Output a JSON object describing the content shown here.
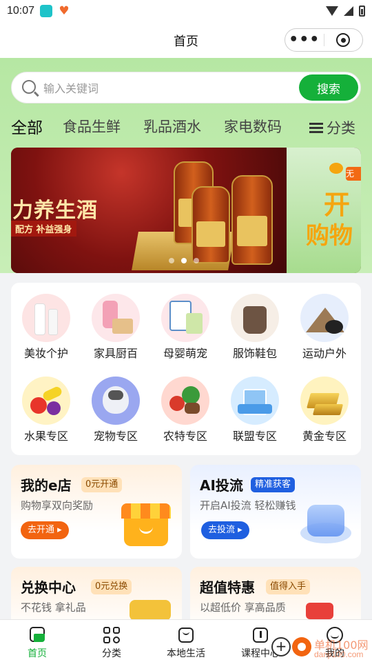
{
  "status_bar": {
    "time": "10:07"
  },
  "nav": {
    "title": "首页",
    "more_icon": "•••"
  },
  "search": {
    "placeholder": "输入关键词",
    "button": "搜索"
  },
  "tabs": [
    "全部",
    "食品生鲜",
    "乳品酒水",
    "家电数码"
  ],
  "category_tab": "分类",
  "banner": {
    "slide_text": "力养生酒",
    "slide_sub": "配方 补益强身",
    "next_text1": "开",
    "next_text2": "购物",
    "next_badge": "无"
  },
  "categories": [
    {
      "label": "美妆个护",
      "icon": "cosmetics-icon"
    },
    {
      "label": "家具厨百",
      "icon": "household-icon"
    },
    {
      "label": "母婴萌宠",
      "icon": "baby-formula-icon"
    },
    {
      "label": "服饰鞋包",
      "icon": "handbag-icon"
    },
    {
      "label": "运动户外",
      "icon": "tent-icon"
    },
    {
      "label": "水果专区",
      "icon": "fruit-icon"
    },
    {
      "label": "宠物专区",
      "icon": "dog-icon"
    },
    {
      "label": "农特专区",
      "icon": "vegetables-icon"
    },
    {
      "label": "联盟专区",
      "icon": "building-icon"
    },
    {
      "label": "黄金专区",
      "icon": "gold-bar-icon"
    }
  ],
  "promos": [
    {
      "title": "我的e店",
      "tag": "0元开通",
      "sub": "购物享双向奖励",
      "button": "去开通 ▸"
    },
    {
      "title": "AI投流",
      "tag": "精准获客",
      "sub": "开启AI投流 轻松赚钱",
      "button": "去投流 ▸"
    },
    {
      "title": "兑换中心",
      "tag": "0元兑换",
      "sub": "不花钱 拿礼品"
    },
    {
      "title": "超值特惠",
      "tag": "值得入手",
      "sub": "以超低价 享高品质"
    }
  ],
  "tabbar": [
    {
      "label": "首页",
      "icon": "home-icon"
    },
    {
      "label": "分类",
      "icon": "grid-icon"
    },
    {
      "label": "本地生活",
      "icon": "shopping-bag-icon"
    },
    {
      "label": "课程中心",
      "icon": "course-icon"
    },
    {
      "label": "我的",
      "icon": "profile-icon"
    }
  ],
  "watermark": {
    "text1": "单机100网",
    "text2": "danji100.com"
  },
  "colors": {
    "brand_green": "#15b03a",
    "header_green": "#b6e7a3",
    "accent_orange": "#f26410",
    "accent_blue": "#1f5fe0"
  }
}
